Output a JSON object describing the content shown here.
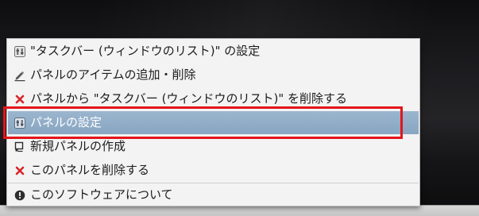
{
  "menu": {
    "items": [
      {
        "label": "\"タスクバー (ウィンドウのリスト)\" の設定",
        "icon": "panel-settings-icon"
      },
      {
        "label": "パネルのアイテムの追加・削除",
        "icon": "edit-items-icon"
      },
      {
        "label": "パネルから \"タスクバー (ウィンドウのリスト)\" を削除する",
        "icon": "remove-icon"
      },
      {
        "label": "パネルの設定",
        "icon": "panel-settings-icon",
        "selected": true
      },
      {
        "label": "新規パネルの作成",
        "icon": "new-panel-icon"
      },
      {
        "label": "このパネルを削除する",
        "icon": "remove-icon"
      },
      {
        "label": "このソフトウェアについて",
        "icon": "info-icon"
      }
    ]
  },
  "colors": {
    "highlight_border": "#e3151b",
    "selected_background": "#8fabc7",
    "remove_icon": "#d9262b"
  }
}
